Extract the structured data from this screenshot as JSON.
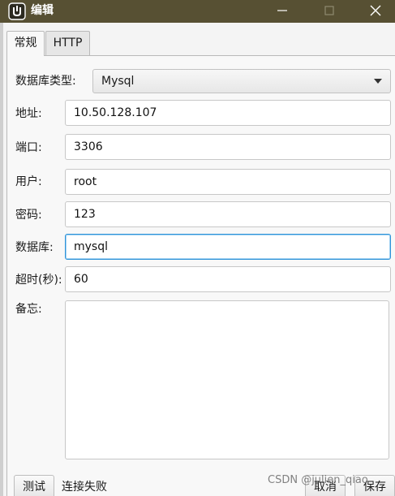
{
  "window": {
    "title": "编辑",
    "app_icon": "app-logo-icon",
    "controls": [
      "minimize-icon",
      "maximize-icon",
      "close-icon"
    ]
  },
  "tabs": [
    {
      "label": "常规",
      "active": true
    },
    {
      "label": "HTTP",
      "active": false
    }
  ],
  "form": {
    "db_type_label": "数据库类型:",
    "db_type_value": "Mysql",
    "address_label": "地址:",
    "address_value": "10.50.128.107",
    "port_label": "端口:",
    "port_value": "3306",
    "user_label": "用户:",
    "user_value": "root",
    "password_label": "密码:",
    "password_value": "123",
    "database_label": "数据库:",
    "database_value": "mysql",
    "timeout_label": "超时(秒):",
    "timeout_value": "60",
    "notes_label": "备忘:",
    "notes_value": ""
  },
  "footer": {
    "test_label": "测试",
    "status_text": "连接失败",
    "cancel_label": "取消",
    "save_label": "保存"
  },
  "watermark": "CSDN @julien_qiao",
  "colors": {
    "titlebar": "#575033",
    "focus_border": "#2f93d8"
  }
}
